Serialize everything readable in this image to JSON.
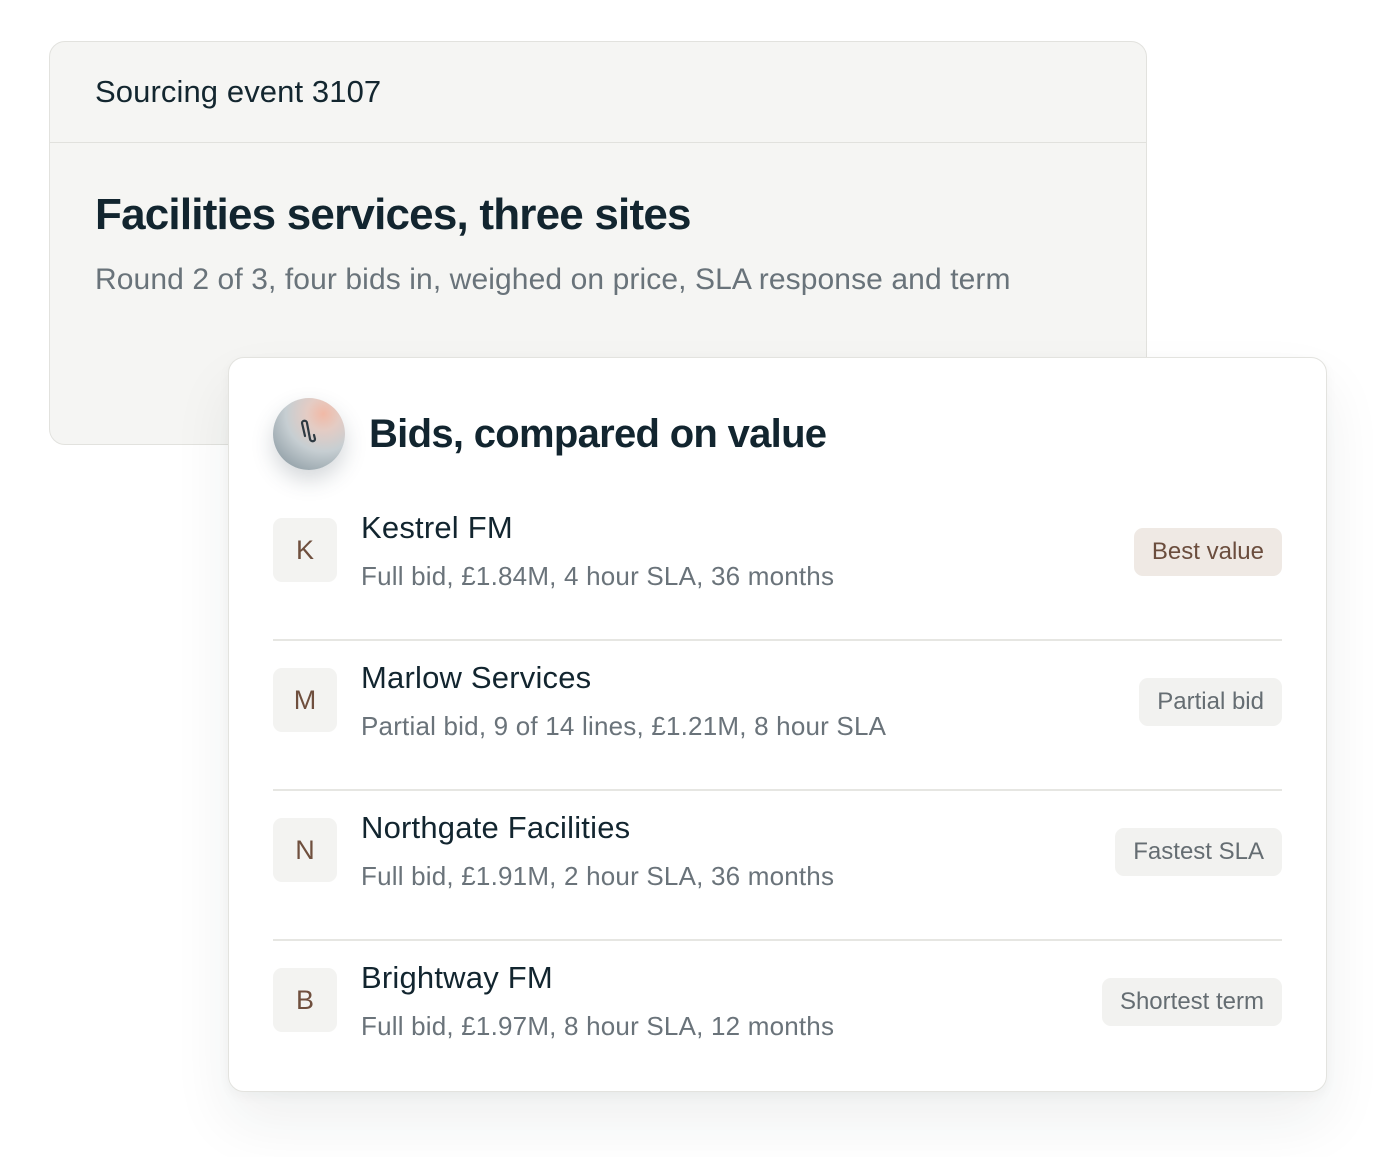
{
  "event": {
    "label": "Sourcing event 3107",
    "title": "Facilities services, three sites",
    "subtitle": "Round 2 of 3, four bids in, weighed on price, SLA response and term"
  },
  "bids": {
    "title": "Bids, compared on value",
    "icon": "paperclip-icon",
    "items": [
      {
        "initial": "K",
        "name": "Kestrel FM",
        "detail": "Full bid, £1.84M, 4 hour SLA, 36 months",
        "badge": "Best value",
        "highlight": true
      },
      {
        "initial": "M",
        "name": "Marlow Services",
        "detail": "Partial bid, 9 of 14 lines, £1.21M, 8 hour SLA",
        "badge": "Partial bid",
        "highlight": false
      },
      {
        "initial": "N",
        "name": "Northgate Facilities",
        "detail": "Full bid, £1.91M, 2 hour SLA, 36 months",
        "badge": "Fastest SLA",
        "highlight": false
      },
      {
        "initial": "B",
        "name": "Brightway FM",
        "detail": "Full bid, £1.97M, 8 hour SLA, 12 months",
        "badge": "Shortest term",
        "highlight": false
      }
    ]
  },
  "colors": {
    "text": "#12252f",
    "muted": "#69737a",
    "card_bg": "#f5f5f3",
    "badge_highlight_bg": "#efe9e4",
    "badge_highlight_text": "#6b4d3d",
    "avatar_text": "#6f4f3e"
  }
}
